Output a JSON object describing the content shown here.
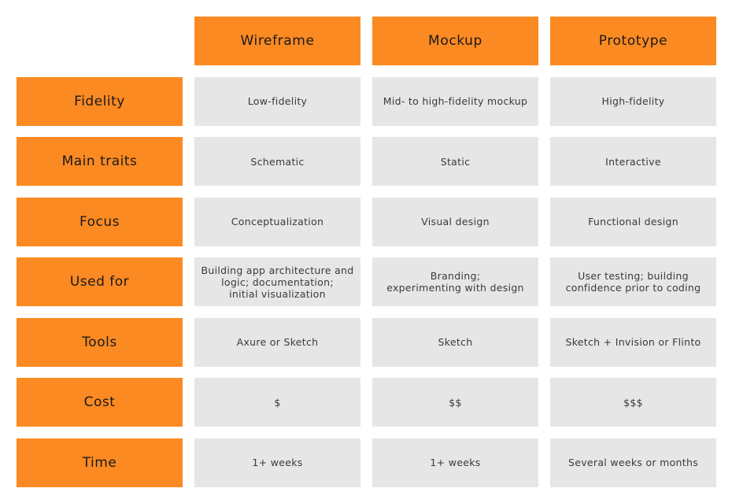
{
  "table": {
    "columns": [
      "Wireframe",
      "Mockup",
      "Prototype"
    ],
    "rows": [
      {
        "label": "Fidelity",
        "values": [
          "Low-fidelity",
          "Mid- to high-fidelity mockup",
          "High-fidelity"
        ]
      },
      {
        "label": "Main traits",
        "values": [
          "Schematic",
          "Static",
          "Interactive"
        ]
      },
      {
        "label": "Focus",
        "values": [
          "Conceptualization",
          "Visual design",
          "Functional design"
        ]
      },
      {
        "label": "Used for",
        "values": [
          "Building app architecture and\nlogic; documentation;\ninitial visualization",
          "Branding;\nexperimenting with design",
          "User testing; building\nconfidence prior to coding"
        ]
      },
      {
        "label": "Tools",
        "values": [
          "Axure or Sketch",
          "Sketch",
          "Sketch + Invision or Flinto"
        ]
      },
      {
        "label": "Cost",
        "values": [
          "$",
          "$$",
          "$$$"
        ]
      },
      {
        "label": "Time",
        "values": [
          "1+ weeks",
          "1+ weeks",
          "Several weeks or months"
        ]
      }
    ]
  },
  "colors": {
    "accent": "#fb8a22",
    "cell_bg": "#e6e6e6",
    "text": "#1a1a1a"
  }
}
